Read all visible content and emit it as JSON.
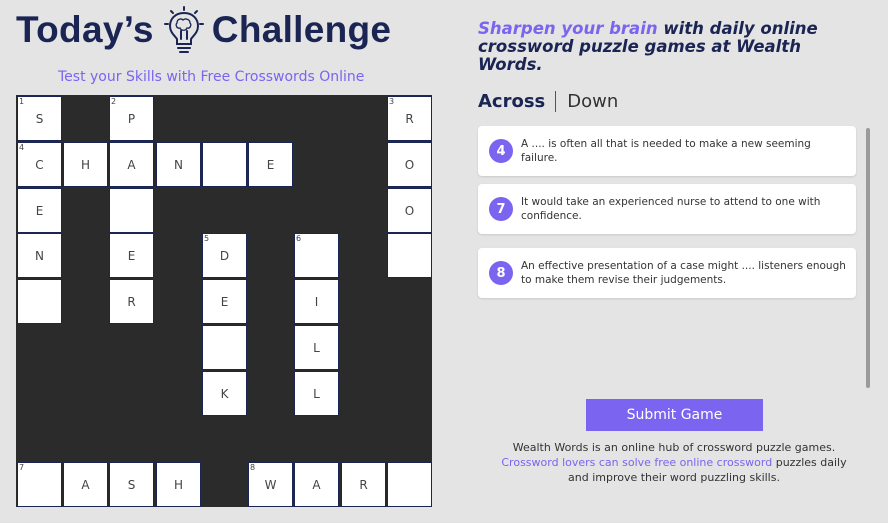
{
  "header": {
    "title_left": "Today’s",
    "title_right": "Challenge",
    "bulb_icon": "lightbulb-brain-icon",
    "subtitle": "Test your Skills with Free Crosswords Online"
  },
  "tagline": {
    "accent": "Sharpen your brain",
    "rest": " with daily online crossword puzzle games at Wealth Words."
  },
  "tabs": {
    "across": "Across",
    "down": "Down"
  },
  "clues": [
    {
      "number": "4",
      "text": "A .... is often all that is needed to make a new seeming failure."
    },
    {
      "number": "7",
      "text": "It would take an experienced nurse to attend to one with confidence."
    },
    {
      "number": "8",
      "text": "An effective presentation of a case might .... listeners enough to make them revise their judgements."
    }
  ],
  "submit_label": "Submit Game",
  "footer": {
    "line1": "Wealth Words is an online hub of crossword puzzle games.",
    "link": "Crossword lovers can solve free online crossword",
    "line2_rest": " puzzles daily",
    "line3": "and improve their word puzzling skills."
  },
  "grid": {
    "rows": 9,
    "cols": 9,
    "cells": [
      {
        "r": 0,
        "c": 0,
        "num": "1",
        "letter": "S"
      },
      {
        "r": 0,
        "c": 2,
        "num": "2",
        "letter": "P"
      },
      {
        "r": 0,
        "c": 8,
        "num": "3",
        "letter": "R"
      },
      {
        "r": 1,
        "c": 0,
        "num": "4",
        "letter": "C"
      },
      {
        "r": 1,
        "c": 1,
        "num": "",
        "letter": "H"
      },
      {
        "r": 1,
        "c": 2,
        "num": "",
        "letter": "A"
      },
      {
        "r": 1,
        "c": 3,
        "num": "",
        "letter": "N"
      },
      {
        "r": 1,
        "c": 4,
        "num": "",
        "letter": ""
      },
      {
        "r": 1,
        "c": 5,
        "num": "",
        "letter": "E"
      },
      {
        "r": 1,
        "c": 8,
        "num": "",
        "letter": "O"
      },
      {
        "r": 2,
        "c": 0,
        "num": "",
        "letter": "E"
      },
      {
        "r": 2,
        "c": 2,
        "num": "",
        "letter": ""
      },
      {
        "r": 2,
        "c": 8,
        "num": "",
        "letter": "O"
      },
      {
        "r": 3,
        "c": 0,
        "num": "",
        "letter": "N"
      },
      {
        "r": 3,
        "c": 2,
        "num": "",
        "letter": "E"
      },
      {
        "r": 3,
        "c": 4,
        "num": "5",
        "letter": "D"
      },
      {
        "r": 3,
        "c": 6,
        "num": "6",
        "letter": ""
      },
      {
        "r": 3,
        "c": 8,
        "num": "",
        "letter": ""
      },
      {
        "r": 4,
        "c": 0,
        "num": "",
        "letter": ""
      },
      {
        "r": 4,
        "c": 2,
        "num": "",
        "letter": "R"
      },
      {
        "r": 4,
        "c": 4,
        "num": "",
        "letter": "E"
      },
      {
        "r": 4,
        "c": 6,
        "num": "",
        "letter": "I"
      },
      {
        "r": 5,
        "c": 4,
        "num": "",
        "letter": ""
      },
      {
        "r": 5,
        "c": 6,
        "num": "",
        "letter": "L"
      },
      {
        "r": 6,
        "c": 4,
        "num": "",
        "letter": "K"
      },
      {
        "r": 6,
        "c": 6,
        "num": "",
        "letter": "L"
      },
      {
        "r": 8,
        "c": 0,
        "num": "7",
        "letter": ""
      },
      {
        "r": 8,
        "c": 1,
        "num": "",
        "letter": "A"
      },
      {
        "r": 8,
        "c": 2,
        "num": "",
        "letter": "S"
      },
      {
        "r": 8,
        "c": 3,
        "num": "",
        "letter": "H"
      },
      {
        "r": 8,
        "c": 5,
        "num": "8",
        "letter": "W"
      },
      {
        "r": 8,
        "c": 6,
        "num": "",
        "letter": "A"
      },
      {
        "r": 8,
        "c": 7,
        "num": "",
        "letter": "R"
      },
      {
        "r": 8,
        "c": 8,
        "num": "",
        "letter": ""
      }
    ]
  },
  "colors": {
    "navy": "#1b2553",
    "accent": "#7a64f0",
    "background": "#e4e4e4",
    "grid_block": "#2b2b2b"
  }
}
